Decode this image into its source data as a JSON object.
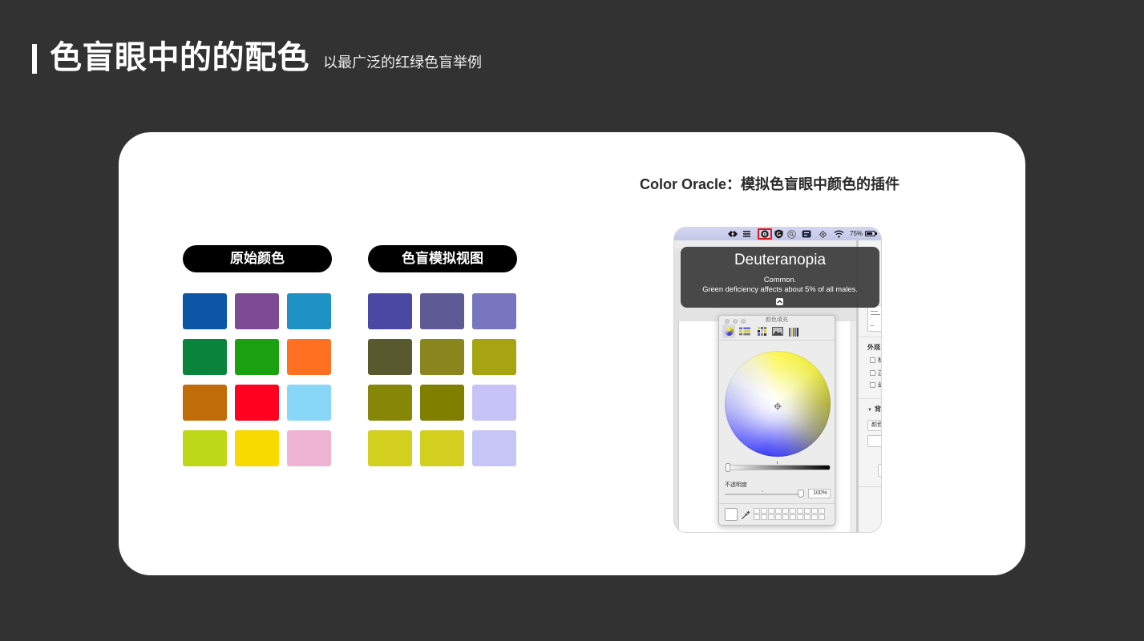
{
  "colors": {
    "background": "#323232",
    "card": "#ffffff",
    "pill": "#000000",
    "pill_text": "#ffffff",
    "highlight": "#e3161c"
  },
  "header": {
    "title": "色盲眼中的的配色",
    "subtitle": "以最广泛的红绿色盲举例"
  },
  "card": {
    "caption": "Color Oracle：模拟色盲眼中颜色的插件",
    "original": {
      "label": "原始颜色",
      "swatches": [
        "#0B56A6",
        "#7D4B93",
        "#1E91C5",
        "#0A843C",
        "#1AA10F",
        "#FF7120",
        "#C06C08",
        "#FF0220",
        "#88D7F8",
        "#BDD818",
        "#F8D900",
        "#EFB3D3"
      ]
    },
    "simulated": {
      "label": "色盲模拟视图",
      "swatches": [
        "#4A48A3",
        "#5D5A95",
        "#7876BF",
        "#595930",
        "#8A851C",
        "#A6A511",
        "#878707",
        "#807F00",
        "#C6C3F7",
        "#D2CF1E",
        "#D2CF1E",
        "#C6C5F6"
      ]
    }
  },
  "screenshot": {
    "menubar": {
      "icons": [
        "code-arrows-icon",
        "lines-icon",
        "color-oracle-icon",
        "shield-icon",
        "search-icon",
        "dictionary-icon",
        "sync-icon",
        "wifi-icon",
        "battery-icon"
      ],
      "battery_label": "75%"
    },
    "tooltip": {
      "title": "Deuteranopia",
      "line1": "Common.",
      "line2": "Green deficiency affects about 5% of all males.",
      "expand_icon": "chevron-up-icon"
    },
    "color_panel": {
      "title": "颜色填充",
      "toolbar_icons": [
        "color-wheel-icon",
        "color-sliders-icon",
        "color-palettes-icon",
        "image-palettes-icon",
        "pencils-icon"
      ],
      "opacity_label": "不透明度",
      "opacity_value": "100%"
    },
    "inspector": {
      "section": "外观",
      "checkboxes": [
        "标",
        "正",
        "幻"
      ],
      "background_heading": "背",
      "fill_select": "颜色"
    }
  }
}
